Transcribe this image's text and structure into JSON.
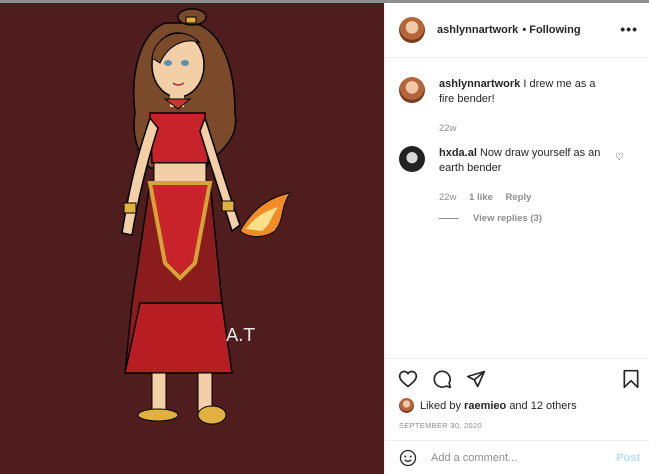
{
  "post": {
    "artist_signature": "A.T"
  },
  "header": {
    "username": "ashlynnartwork",
    "follow_status": "• Following",
    "more_icon": "more-options-icon"
  },
  "comments": [
    {
      "username": "ashlynnartwork",
      "text": "I drew me as a fire bender!",
      "time": "22w"
    },
    {
      "username": "hxda.al",
      "text": "Now draw yourself as an earth bender",
      "time": "22w",
      "likes": "1 like",
      "reply_label": "Reply",
      "view_replies": "View replies (3)"
    }
  ],
  "actions": {
    "icons": [
      "heart-icon",
      "comment-icon",
      "share-icon",
      "bookmark-icon"
    ],
    "liked_by_prefix": "Liked by",
    "liked_by_user": "raemieo",
    "liked_by_suffix": "and 12 others",
    "date": "SEPTEMBER 30, 2020"
  },
  "add_comment": {
    "placeholder": "Add a comment...",
    "post_label": "Post"
  },
  "colors": {
    "image_bg": "#4f1d1e",
    "post_button": "#b2dffc"
  }
}
